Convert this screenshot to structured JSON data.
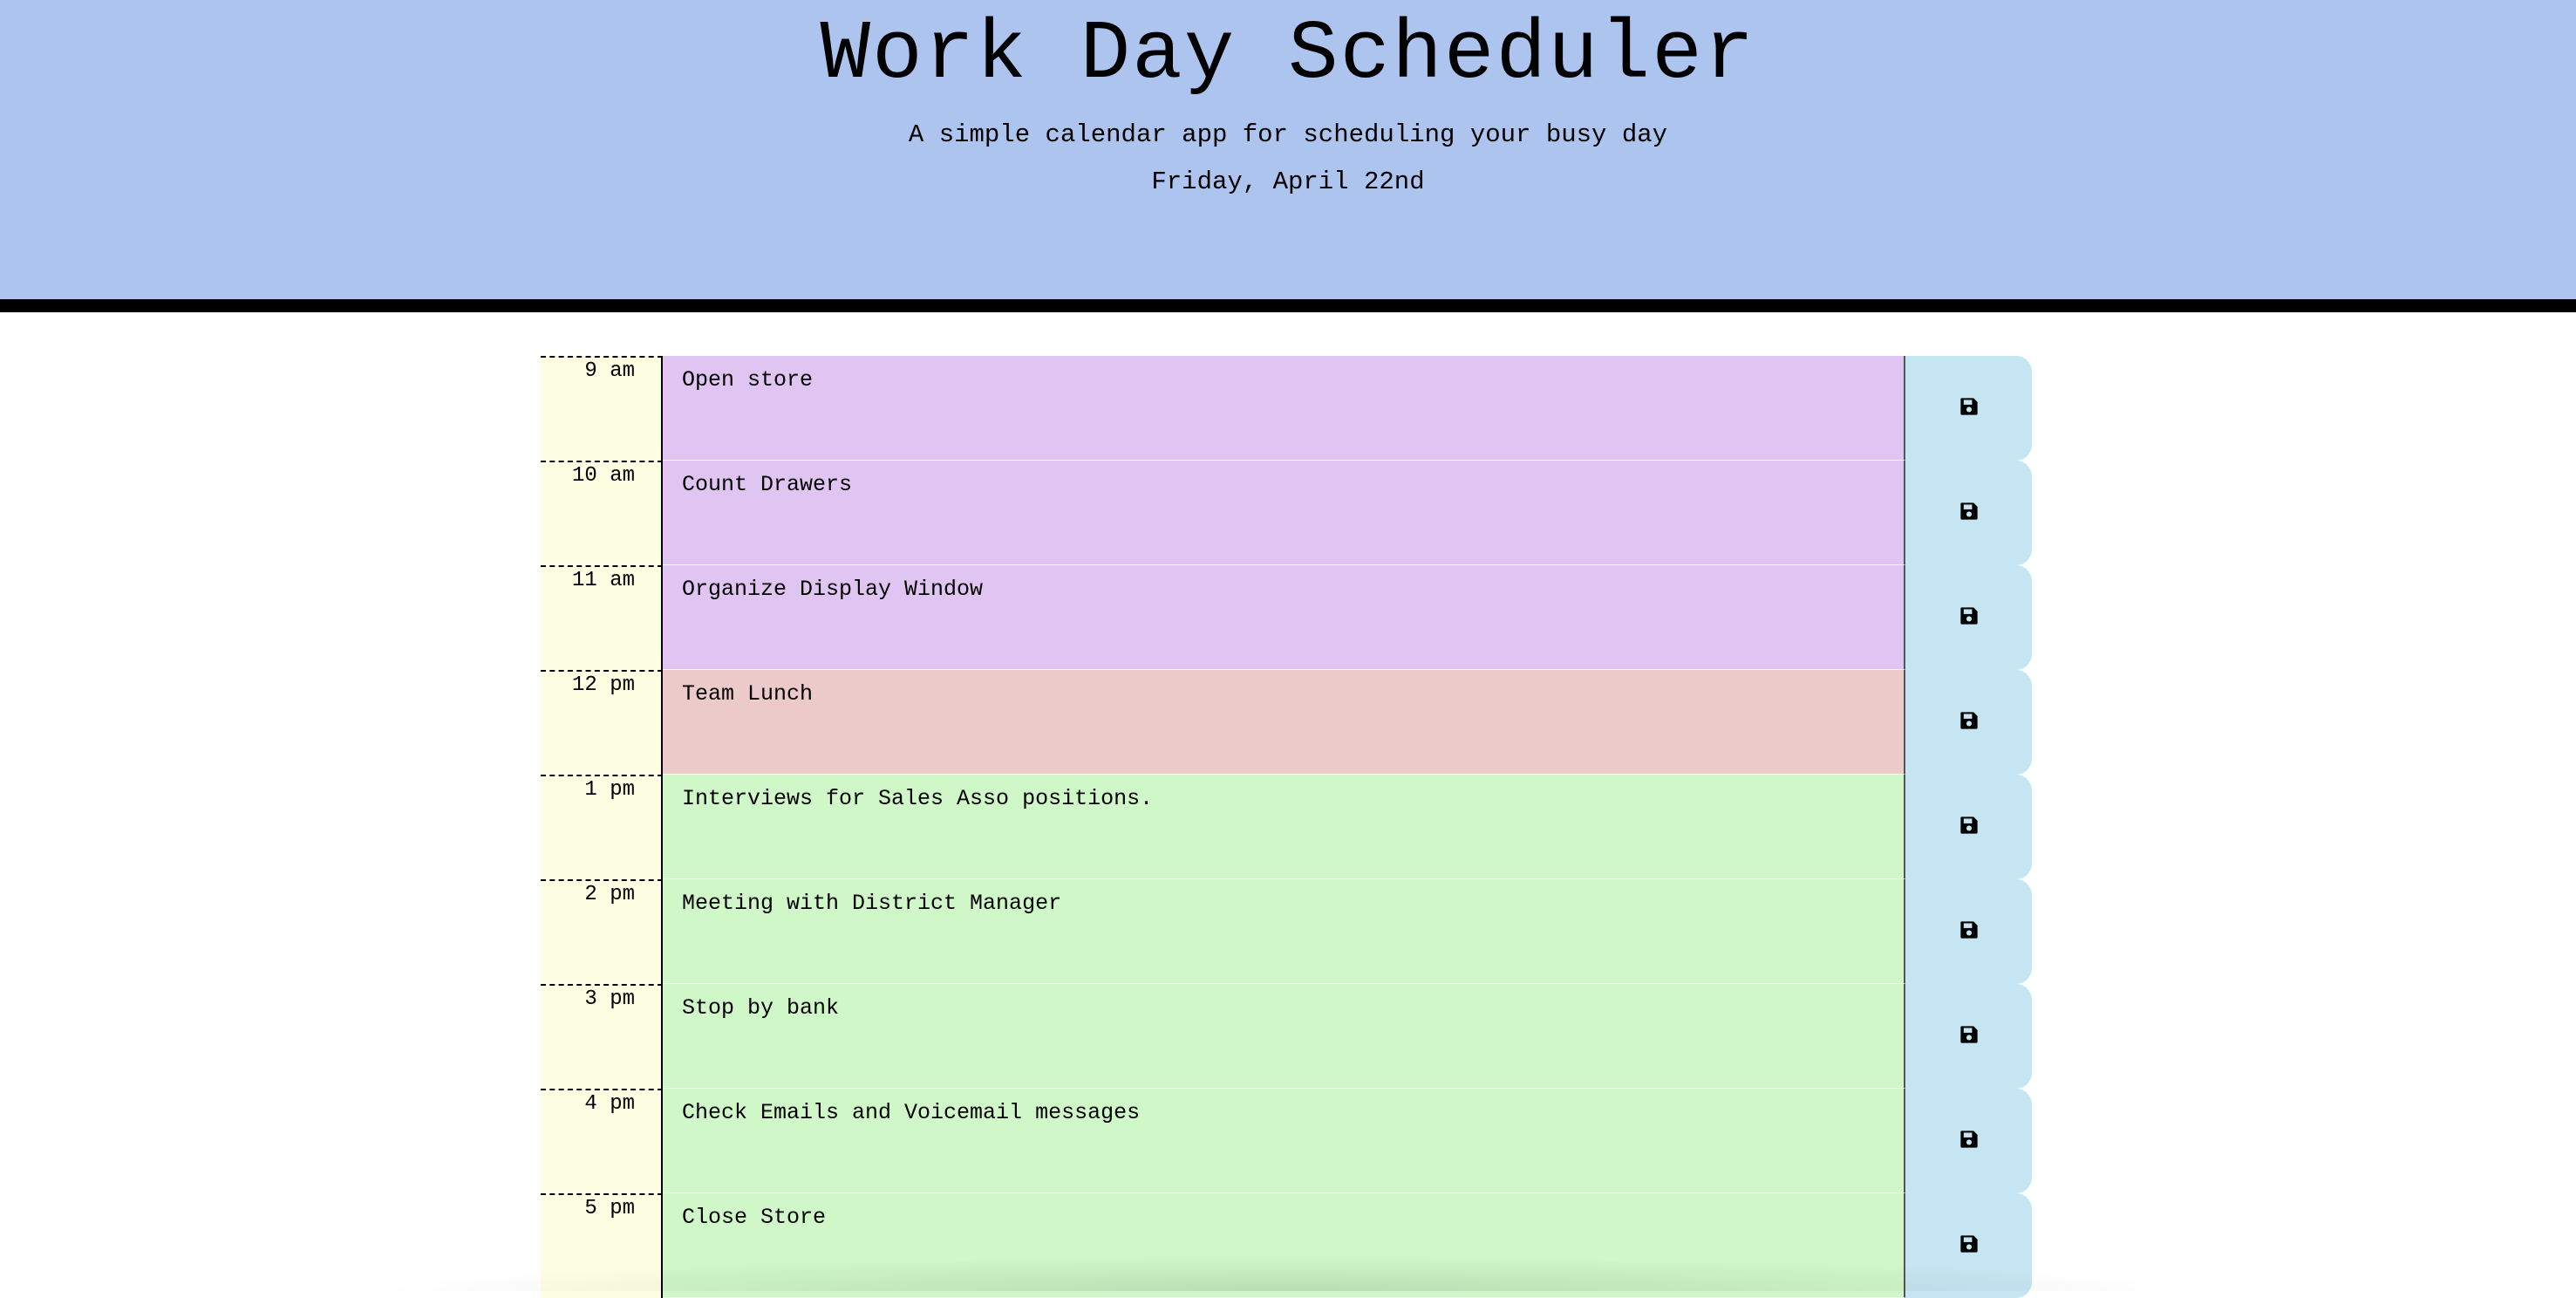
{
  "header": {
    "title": "Work Day Scheduler",
    "subtitle": "A simple calendar app for scheduling your busy day",
    "current_day": "Friday, April 22nd"
  },
  "colors": {
    "header_bg": "#adc4ee",
    "hour_bg": "#fefee2",
    "past": "#e0c5f3",
    "present": "#eccaca",
    "future": "#cff7c8",
    "save_bg": "#c4e5f1"
  },
  "rows": [
    {
      "hour": "9 am",
      "text": "Open store",
      "state": "past",
      "save_icon": "floppy-disk-icon"
    },
    {
      "hour": "10 am",
      "text": "Count Drawers",
      "state": "past",
      "save_icon": "floppy-disk-icon"
    },
    {
      "hour": "11 am",
      "text": "Organize Display Window",
      "state": "past",
      "save_icon": "floppy-disk-icon"
    },
    {
      "hour": "12 pm",
      "text": "Team Lunch",
      "state": "present",
      "save_icon": "floppy-disk-icon"
    },
    {
      "hour": "1 pm",
      "text": "Interviews for Sales Asso positions.",
      "state": "future",
      "save_icon": "floppy-disk-icon"
    },
    {
      "hour": "2 pm",
      "text": "Meeting with District Manager",
      "state": "future",
      "save_icon": "floppy-disk-icon"
    },
    {
      "hour": "3 pm",
      "text": "Stop by bank",
      "state": "future",
      "save_icon": "floppy-disk-icon"
    },
    {
      "hour": "4 pm",
      "text": "Check Emails and Voicemail messages",
      "state": "future",
      "save_icon": "floppy-disk-icon"
    },
    {
      "hour": "5 pm",
      "text": "Close Store",
      "state": "future",
      "save_icon": "floppy-disk-icon"
    }
  ]
}
